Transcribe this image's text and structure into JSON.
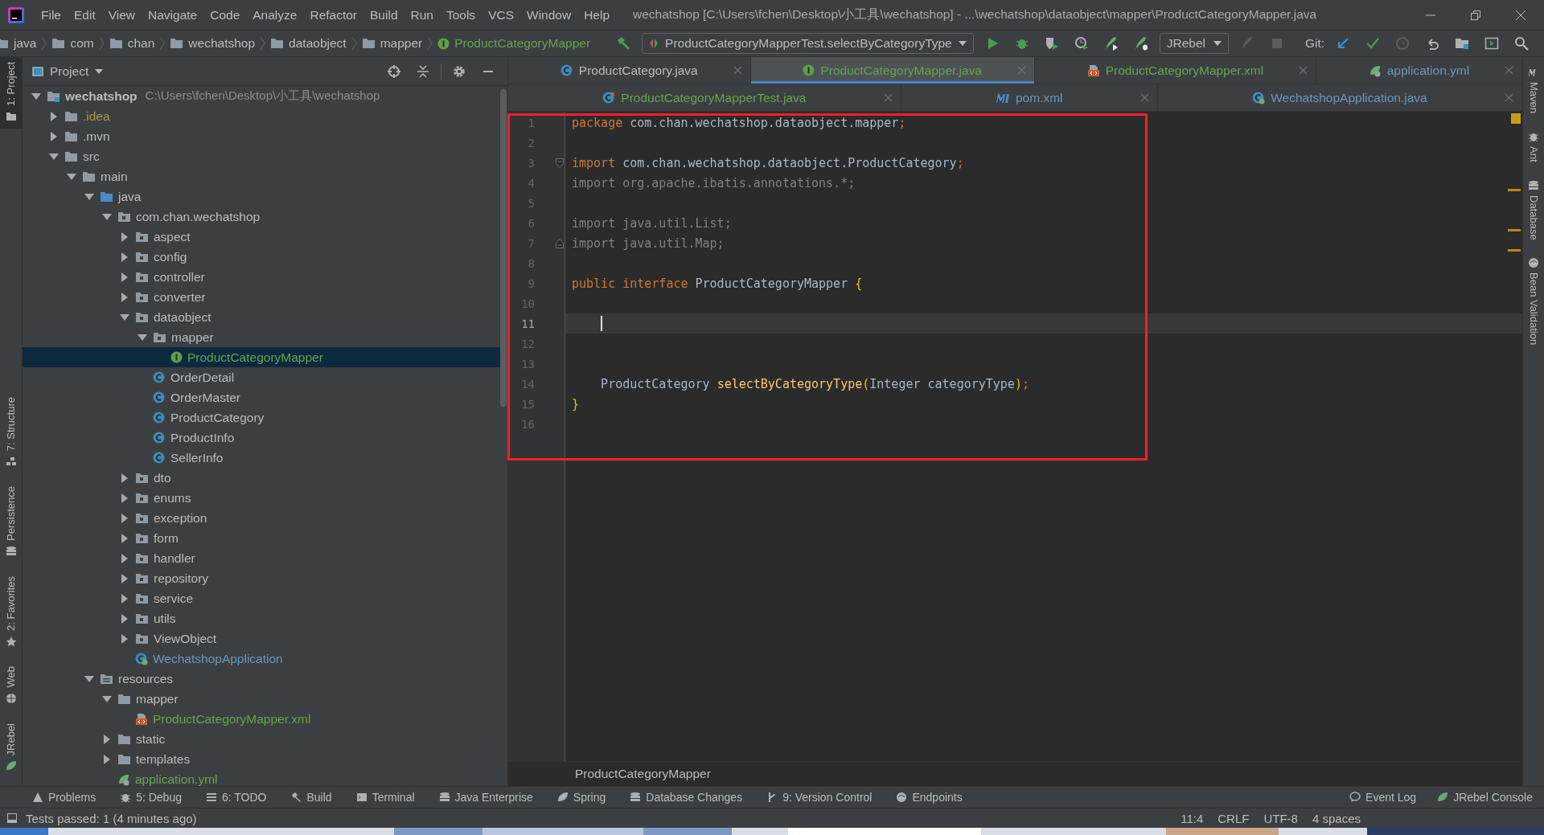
{
  "menu": [
    "File",
    "Edit",
    "View",
    "Navigate",
    "Code",
    "Analyze",
    "Refactor",
    "Build",
    "Run",
    "Tools",
    "VCS",
    "Window",
    "Help"
  ],
  "window_title": "wechatshop [C:\\Users\\fchen\\Desktop\\小工具\\wechatshop] - ...\\wechatshop\\dataobject\\mapper\\ProductCategoryMapper.java",
  "breadcrumbs": [
    {
      "label": "java",
      "kind": "folder"
    },
    {
      "label": "com",
      "kind": "folder"
    },
    {
      "label": "chan",
      "kind": "folder"
    },
    {
      "label": "wechatshop",
      "kind": "folder"
    },
    {
      "label": "dataobject",
      "kind": "folder"
    },
    {
      "label": "mapper",
      "kind": "folder"
    },
    {
      "label": "ProductCategoryMapper",
      "kind": "interface"
    }
  ],
  "run_config": "ProductCategoryMapperTest.selectByCategoryType",
  "jrebel": "JRebel",
  "git_label": "Git:",
  "left_tool_windows": [
    {
      "label": "1: Project",
      "kind": "project",
      "selected": true
    },
    {
      "label": "7: Structure",
      "kind": "structure",
      "selected": false
    },
    {
      "label": "Persistence",
      "kind": "persistence",
      "selected": false
    },
    {
      "label": "2: Favorites",
      "kind": "favorites",
      "selected": false
    },
    {
      "label": "Web",
      "kind": "web",
      "selected": false
    },
    {
      "label": "JRebel",
      "kind": "jrebel",
      "selected": false
    }
  ],
  "project": {
    "title": "Project",
    "tree": [
      {
        "label": "wechatshop",
        "path": "C:\\Users\\fchen\\Desktop\\小工具\\wechatshop",
        "kind": "project",
        "expanded": true,
        "selected": false,
        "color": "#bbbbbb",
        "children": [
          {
            "label": ".idea",
            "kind": "folder",
            "expanded": false,
            "selected": false,
            "color": "#a69b48"
          },
          {
            "label": ".mvn",
            "kind": "folder",
            "expanded": false,
            "selected": false,
            "color": "#bbbbbb"
          },
          {
            "label": "src",
            "kind": "folder",
            "expanded": true,
            "selected": false,
            "color": "#bbbbbb",
            "children": [
              {
                "label": "main",
                "kind": "folder",
                "expanded": true,
                "selected": false,
                "color": "#bbbbbb",
                "children": [
                  {
                    "label": "java",
                    "kind": "source-folder",
                    "expanded": true,
                    "selected": false,
                    "color": "#bbbbbb",
                    "children": [
                      {
                        "label": "com.chan.wechatshop",
                        "kind": "package",
                        "expanded": true,
                        "selected": false,
                        "color": "#bbbbbb",
                        "children": [
                          {
                            "label": "aspect",
                            "kind": "package",
                            "expanded": false,
                            "selected": false,
                            "color": "#bbbbbb"
                          },
                          {
                            "label": "config",
                            "kind": "package",
                            "expanded": false,
                            "selected": false,
                            "color": "#bbbbbb"
                          },
                          {
                            "label": "controller",
                            "kind": "package",
                            "expanded": false,
                            "selected": false,
                            "color": "#bbbbbb"
                          },
                          {
                            "label": "converter",
                            "kind": "package",
                            "expanded": false,
                            "selected": false,
                            "color": "#bbbbbb"
                          },
                          {
                            "label": "dataobject",
                            "kind": "package",
                            "expanded": true,
                            "selected": false,
                            "color": "#bbbbbb",
                            "children": [
                              {
                                "label": "mapper",
                                "kind": "package",
                                "expanded": true,
                                "selected": false,
                                "color": "#bbbbbb",
                                "children": [
                                  {
                                    "label": "ProductCategoryMapper",
                                    "kind": "interface",
                                    "selected": true,
                                    "color": "#62a550"
                                  }
                                ]
                              },
                              {
                                "label": "OrderDetail",
                                "kind": "class",
                                "selected": false,
                                "color": "#bbbbbb"
                              },
                              {
                                "label": "OrderMaster",
                                "kind": "class",
                                "selected": false,
                                "color": "#bbbbbb"
                              },
                              {
                                "label": "ProductCategory",
                                "kind": "class",
                                "selected": false,
                                "color": "#bbbbbb"
                              },
                              {
                                "label": "ProductInfo",
                                "kind": "class",
                                "selected": false,
                                "color": "#bbbbbb"
                              },
                              {
                                "label": "SellerInfo",
                                "kind": "class",
                                "selected": false,
                                "color": "#bbbbbb"
                              }
                            ]
                          },
                          {
                            "label": "dto",
                            "kind": "package",
                            "expanded": false,
                            "selected": false,
                            "color": "#bbbbbb"
                          },
                          {
                            "label": "enums",
                            "kind": "package",
                            "expanded": false,
                            "selected": false,
                            "color": "#bbbbbb"
                          },
                          {
                            "label": "exception",
                            "kind": "package",
                            "expanded": false,
                            "selected": false,
                            "color": "#bbbbbb"
                          },
                          {
                            "label": "form",
                            "kind": "package",
                            "expanded": false,
                            "selected": false,
                            "color": "#bbbbbb"
                          },
                          {
                            "label": "handler",
                            "kind": "package",
                            "expanded": false,
                            "selected": false,
                            "color": "#bbbbbb"
                          },
                          {
                            "label": "repository",
                            "kind": "package",
                            "expanded": false,
                            "selected": false,
                            "color": "#bbbbbb"
                          },
                          {
                            "label": "service",
                            "kind": "package",
                            "expanded": false,
                            "selected": false,
                            "color": "#bbbbbb"
                          },
                          {
                            "label": "utils",
                            "kind": "package",
                            "expanded": false,
                            "selected": false,
                            "color": "#bbbbbb"
                          },
                          {
                            "label": "ViewObject",
                            "kind": "package",
                            "expanded": false,
                            "selected": false,
                            "color": "#bbbbbb"
                          },
                          {
                            "label": "WechatshopApplication",
                            "kind": "spring-class",
                            "selected": false,
                            "color": "#6897bb"
                          }
                        ]
                      }
                    ]
                  },
                  {
                    "label": "resources",
                    "kind": "resource-folder",
                    "expanded": true,
                    "selected": false,
                    "color": "#bbbbbb",
                    "children": [
                      {
                        "label": "mapper",
                        "kind": "folder",
                        "expanded": true,
                        "selected": false,
                        "color": "#bbbbbb",
                        "children": [
                          {
                            "label": "ProductCategoryMapper.xml",
                            "kind": "xml",
                            "selected": false,
                            "color": "#62a550"
                          }
                        ]
                      },
                      {
                        "label": "static",
                        "kind": "folder",
                        "expanded": false,
                        "selected": false,
                        "color": "#bbbbbb"
                      },
                      {
                        "label": "templates",
                        "kind": "folder",
                        "expanded": false,
                        "selected": false,
                        "color": "#bbbbbb"
                      },
                      {
                        "label": "application.yml",
                        "kind": "yml",
                        "selected": false,
                        "color": "#62a550"
                      }
                    ]
                  }
                ]
              }
            ]
          }
        ]
      }
    ]
  },
  "editor_tabs": [
    [
      {
        "label": "ProductCategory.java",
        "kind": "class",
        "color": "#bbbbbb",
        "selected": false
      },
      {
        "label": "ProductCategoryMapper.java",
        "kind": "interface",
        "color": "#62a550",
        "selected": true
      },
      {
        "label": "ProductCategoryMapper.xml",
        "kind": "xml",
        "color": "#62a550",
        "selected": false
      },
      {
        "label": "application.yml",
        "kind": "yml",
        "color": "#6897bb",
        "selected": false
      }
    ],
    [
      {
        "label": "ProductCategoryMapperTest.java",
        "kind": "test-class",
        "color": "#62a550",
        "selected": false
      },
      {
        "label": "pom.xml",
        "kind": "maven",
        "color": "#6897bb",
        "selected": false
      },
      {
        "label": "WechatshopApplication.java",
        "kind": "spring-class",
        "color": "#6897bb",
        "selected": false
      }
    ]
  ],
  "code_lines": [
    {
      "number": "1",
      "selected": false,
      "segments": [
        {
          "text": "package",
          "kind": "keyword"
        },
        {
          "text": " com.chan.wechatshop.dataobject.mapper",
          "kind": "plain"
        },
        {
          "text": ";",
          "kind": "punct"
        }
      ]
    },
    {
      "number": "2",
      "selected": false
    },
    {
      "number": "3",
      "selected": false,
      "kind": "fold-start",
      "segments": [
        {
          "text": "import",
          "kind": "keyword"
        },
        {
          "text": " com.chan.wechatshop.dataobject.ProductCategory",
          "kind": "plain"
        },
        {
          "text": ";",
          "kind": "punct"
        }
      ]
    },
    {
      "number": "4",
      "selected": false,
      "segments": [
        {
          "text": "import org.apache.ibatis.annotations.*;",
          "kind": "unused"
        }
      ]
    },
    {
      "number": "5",
      "selected": false
    },
    {
      "number": "6",
      "selected": false,
      "segments": [
        {
          "text": "import java.util.List;",
          "kind": "unused"
        }
      ]
    },
    {
      "number": "7",
      "selected": false,
      "kind": "fold-end",
      "segments": [
        {
          "text": "import java.util.Map;",
          "kind": "unused"
        }
      ]
    },
    {
      "number": "8",
      "selected": false
    },
    {
      "number": "9",
      "selected": false,
      "segments": [
        {
          "text": "public interface",
          "kind": "keyword"
        },
        {
          "text": " ProductCategoryMapper ",
          "kind": "plain"
        },
        {
          "text": "{",
          "kind": "brace"
        }
      ]
    },
    {
      "number": "10",
      "selected": false
    },
    {
      "number": "11",
      "selected": true
    },
    {
      "number": "12",
      "selected": false
    },
    {
      "number": "13",
      "selected": false
    },
    {
      "number": "14",
      "selected": false,
      "segments": [
        {
          "text": "    ProductCategory ",
          "kind": "plain"
        },
        {
          "text": "selectByCategoryType",
          "kind": "method"
        },
        {
          "text": "(",
          "kind": "brace"
        },
        {
          "text": "Integer categoryType",
          "kind": "plain"
        },
        {
          "text": ")",
          "kind": "brace"
        },
        {
          "text": ";",
          "kind": "punct"
        }
      ]
    },
    {
      "number": "15",
      "selected": false,
      "segments": [
        {
          "text": "}",
          "kind": "brace"
        }
      ]
    },
    {
      "number": "16",
      "selected": false
    }
  ],
  "annotation_frame": {
    "kind": "rectangle"
  },
  "editor_breadcrumb": "ProductCategoryMapper",
  "right_tool_windows": [
    {
      "label": "Maven",
      "kind": "maven"
    },
    {
      "label": "Ant",
      "kind": "ant"
    },
    {
      "label": "Database",
      "kind": "database"
    },
    {
      "label": "Bean Validation",
      "kind": "bean"
    }
  ],
  "bottom_tools": [
    {
      "label": "Problems",
      "kind": "problems"
    },
    {
      "label": "5: Debug",
      "kind": "debug"
    },
    {
      "label": "6: TODO",
      "kind": "todo"
    },
    {
      "label": "Build",
      "kind": "build"
    },
    {
      "label": "Terminal",
      "kind": "terminal"
    },
    {
      "label": "Java Enterprise",
      "kind": "enterprise"
    },
    {
      "label": "Spring",
      "kind": "spring"
    },
    {
      "label": "Database Changes",
      "kind": "database"
    },
    {
      "label": "9: Version Control",
      "kind": "vcs"
    },
    {
      "label": "Endpoints",
      "kind": "endpoints"
    }
  ],
  "bottom_right_tools": [
    {
      "label": "Event Log",
      "kind": "log"
    },
    {
      "label": "JRebel Console",
      "kind": "jrebel"
    }
  ],
  "status": {
    "message": "Tests passed: 1 (4 minutes ago)",
    "items": [
      "11:4",
      "CRLF",
      "UTF-8",
      "4 spaces"
    ]
  }
}
